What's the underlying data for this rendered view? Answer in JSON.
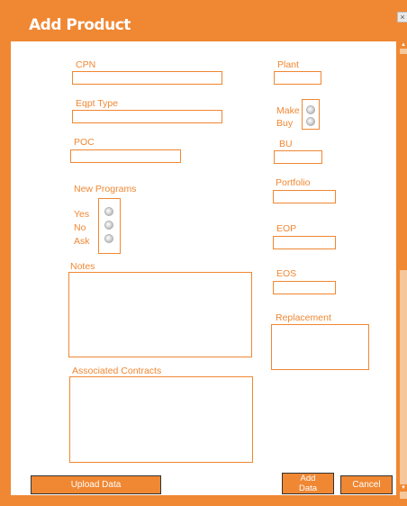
{
  "dialog": {
    "title": "Add Product",
    "close": "×"
  },
  "fields": {
    "cpn": {
      "label": "CPN",
      "value": ""
    },
    "eqpt_type": {
      "label": "Eqpt Type",
      "value": ""
    },
    "poc": {
      "label": "POC",
      "value": ""
    },
    "new_programs": {
      "label": "New Programs",
      "options": [
        "Yes",
        "No",
        "Ask"
      ]
    },
    "notes": {
      "label": "Notes",
      "value": ""
    },
    "associated_contracts": {
      "label": "Associated Contracts",
      "value": ""
    },
    "plant": {
      "label": "Plant",
      "value": ""
    },
    "make_buy": {
      "options": [
        "Make",
        "Buy"
      ]
    },
    "bu": {
      "label": "BU",
      "value": ""
    },
    "portfolio": {
      "label": "Portfolio",
      "value": ""
    },
    "eop": {
      "label": "EOP",
      "value": ""
    },
    "eos": {
      "label": "EOS",
      "value": ""
    },
    "replacement": {
      "label": "Replacement",
      "value": ""
    }
  },
  "buttons": {
    "upload": "Upload Data",
    "add": "Add Data",
    "cancel": "Cancel"
  },
  "colors": {
    "accent": "#f08732",
    "scroll_track": "#f5c79a"
  },
  "icons": {
    "close": "close-icon",
    "radio": "radio-button-icon"
  }
}
